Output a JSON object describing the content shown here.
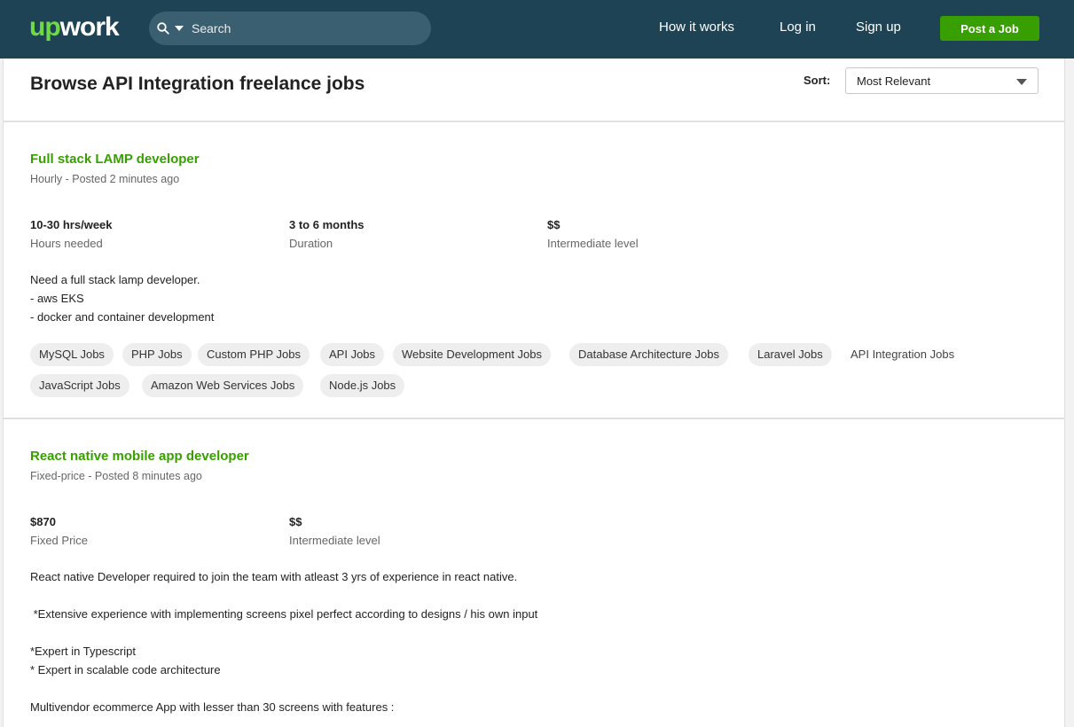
{
  "header": {
    "logo_up": "up",
    "logo_work": "work",
    "search_placeholder": "Search",
    "nav": [
      "How it works",
      "Log in",
      "Sign up"
    ],
    "post_job": "Post a Job"
  },
  "browse": {
    "title": "Browse API Integration freelance jobs",
    "sort_label": "Sort:",
    "sort_value": "Most Relevant"
  },
  "jobs": [
    {
      "title": "Full stack LAMP developer",
      "meta": "Hourly - Posted 2 minutes ago",
      "stats": [
        {
          "value": "10-30 hrs/week",
          "label": "Hours needed"
        },
        {
          "value": "3 to 6 months",
          "label": "Duration"
        },
        {
          "value": "$$",
          "label": "Intermediate level"
        }
      ],
      "description": [
        "Need a full stack lamp developer.",
        "- aws EKS",
        "- docker and container development"
      ],
      "tags": [
        "MySQL Jobs",
        "PHP Jobs",
        "Custom PHP Jobs",
        "API Jobs",
        "Website Development Jobs",
        "Database Architecture Jobs",
        "Laravel Jobs",
        "API Integration Jobs",
        "JavaScript Jobs",
        "Amazon Web Services Jobs",
        "Node.js Jobs"
      ]
    },
    {
      "title": "React native mobile app developer",
      "meta": "Fixed-price - Posted 8 minutes ago",
      "stats": [
        {
          "value": "$870",
          "label": "Fixed Price"
        },
        {
          "value": "$$",
          "label": "Intermediate level"
        }
      ],
      "description": [
        "React native Developer required to join the team with atleast 3 yrs of experience in react native.",
        " *Extensive experience with implementing screens pixel perfect according to designs / his own input",
        "*Expert in Typescript",
        "* Expert in scalable code architecture",
        "Multivendor ecommerce App with lesser than 30 screens with features :"
      ]
    }
  ],
  "colors": {
    "topbar": "#1d4354",
    "accent_green": "#37a000",
    "logo_green": "#6fda44"
  }
}
